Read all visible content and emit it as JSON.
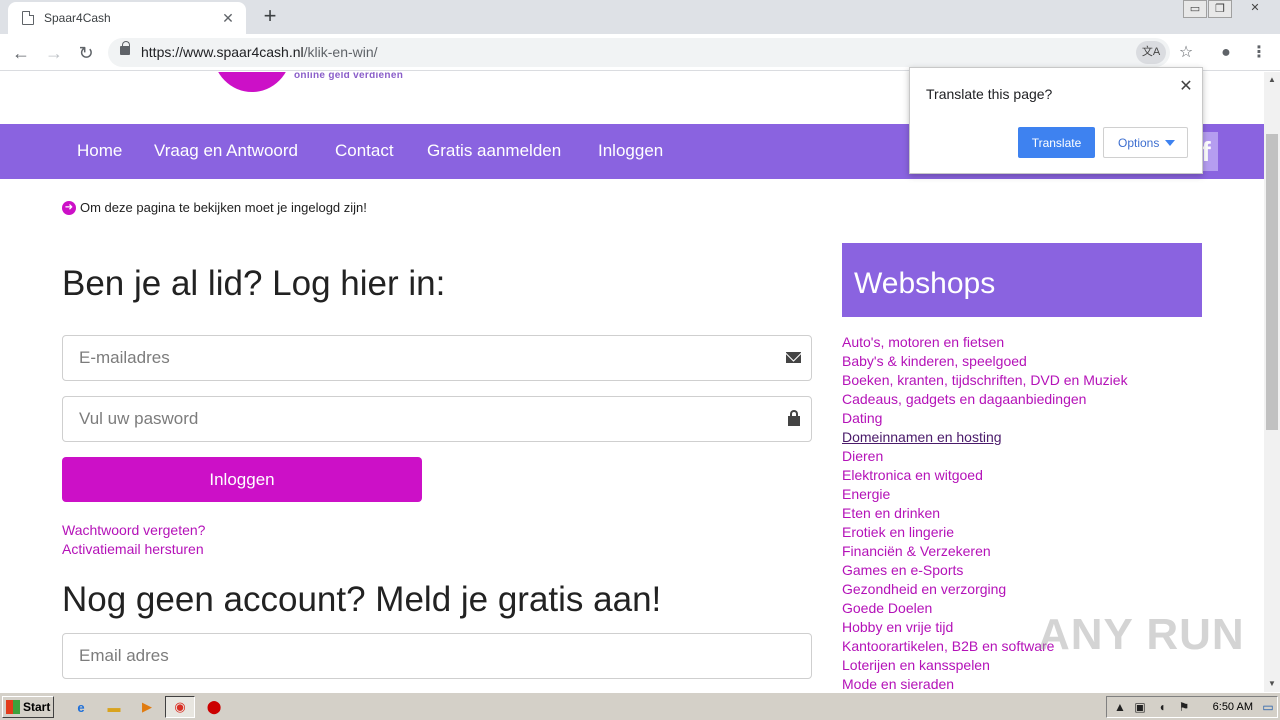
{
  "browser": {
    "tab_title": "Spaar4Cash",
    "tab_close": "✕",
    "new_tab": "+",
    "url_host": "https://www.spaar4cash.nl",
    "url_path": "/klik-en-win/",
    "window_controls": [
      "▭",
      "❐",
      "✕"
    ]
  },
  "site": {
    "logo_tagline": "online geld verdienen",
    "nav": [
      "Home",
      "Vraag en Antwoord",
      "Contact",
      "Gratis aanmelden",
      "Inloggen"
    ],
    "social_letter": "f",
    "notice": "Om deze pagina te bekijken moet je ingelogd zijn!",
    "login": {
      "heading": "Ben je al lid? Log hier in:",
      "email_placeholder": "E-mailadres",
      "password_placeholder": "Vul uw pasword",
      "button": "Inloggen",
      "forgot": "Wachtwoord vergeten?",
      "resend": "Activatiemail hersturen"
    },
    "register": {
      "heading": "Nog geen account? Meld je gratis aan!",
      "email_placeholder": "Email adres"
    },
    "webshops": {
      "title": "Webshops",
      "items": [
        "Auto's, motoren en fietsen",
        "Baby's & kinderen, speelgoed",
        "Boeken, kranten, tijdschriften, DVD en Muziek",
        "Cadeaus, gadgets en dagaanbiedingen",
        "Dating",
        "Domeinnamen en hosting",
        "Dieren",
        "Elektronica en witgoed",
        "Energie",
        "Eten en drinken",
        "Erotiek en lingerie",
        "Financiën & Verzekeren",
        "Games en e-Sports",
        "Gezondheid en verzorging",
        "Goede Doelen",
        "Hobby en vrije tijd",
        "Kantoorartikelen, B2B en software",
        "Loterijen en kansspelen",
        "Mode en sieraden"
      ],
      "hover_index": 5
    }
  },
  "translate_popup": {
    "title": "Translate this page?",
    "translate_button": "Translate",
    "options_button": "Options"
  },
  "watermark": "ANY RUN",
  "taskbar": {
    "start_label": "Start",
    "clock": "6:50 AM"
  },
  "colors": {
    "brand_purple": "#8a63e0",
    "brand_magenta": "#cc10c7",
    "link_magenta": "#b412b8",
    "chrome_blue": "#3e82f0"
  }
}
